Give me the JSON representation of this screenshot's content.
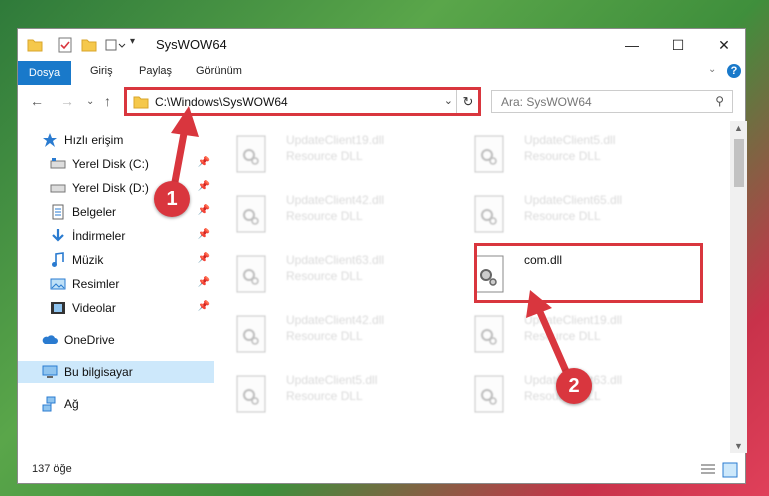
{
  "window": {
    "title": "SysWOW64"
  },
  "ribbon": {
    "tabs": [
      "Dosya",
      "Giriş",
      "Paylaş",
      "Görünüm"
    ]
  },
  "address": {
    "path": "C:\\Windows\\SysWOW64"
  },
  "search": {
    "placeholder": "Ara: SysWOW64"
  },
  "sidebar": {
    "items": [
      {
        "label": "Hızlı erişim",
        "icon": "star-icon",
        "pinned": false
      },
      {
        "label": "Yerel Disk (C:)",
        "icon": "drive-icon",
        "pinned": true
      },
      {
        "label": "Yerel Disk (D:)",
        "icon": "drive-icon",
        "pinned": true
      },
      {
        "label": "Belgeler",
        "icon": "document-icon",
        "pinned": true
      },
      {
        "label": "İndirmeler",
        "icon": "download-icon",
        "pinned": true
      },
      {
        "label": "Müzik",
        "icon": "music-icon",
        "pinned": true
      },
      {
        "label": "Resimler",
        "icon": "pictures-icon",
        "pinned": true
      },
      {
        "label": "Videolar",
        "icon": "video-icon",
        "pinned": true
      },
      {
        "label": "OneDrive",
        "icon": "cloud-icon",
        "pinned": false
      },
      {
        "label": "Bu bilgisayar",
        "icon": "computer-icon",
        "pinned": false
      },
      {
        "label": "Ağ",
        "icon": "network-icon",
        "pinned": false
      }
    ]
  },
  "files": [
    {
      "name": "UpdateClient19.dll",
      "desc": "Resource DLL"
    },
    {
      "name": "UpdateClient5.dll",
      "desc": "Resource DLL"
    },
    {
      "name": "UpdateClient42.dll",
      "desc": "Resource DLL"
    },
    {
      "name": "UpdateClient65.dll",
      "desc": "Resource DLL"
    },
    {
      "name": "UpdateClient63.dll",
      "desc": "Resource DLL"
    },
    {
      "name": "com.dll",
      "desc": ""
    },
    {
      "name": "UpdateClient42.dll",
      "desc": "Resource DLL"
    },
    {
      "name": "UpdateClient19.dll",
      "desc": "Resource DLL"
    },
    {
      "name": "UpdateClient5.dll",
      "desc": "Resource DLL"
    },
    {
      "name": "UpdateClient63.dll",
      "desc": "Resource DLL"
    }
  ],
  "status": {
    "count": "137 öğe"
  },
  "annotations": {
    "step1": "1",
    "step2": "2"
  },
  "colors": {
    "accent": "#1979ca",
    "highlight": "#d9363e",
    "selected": "#cde8fb"
  }
}
